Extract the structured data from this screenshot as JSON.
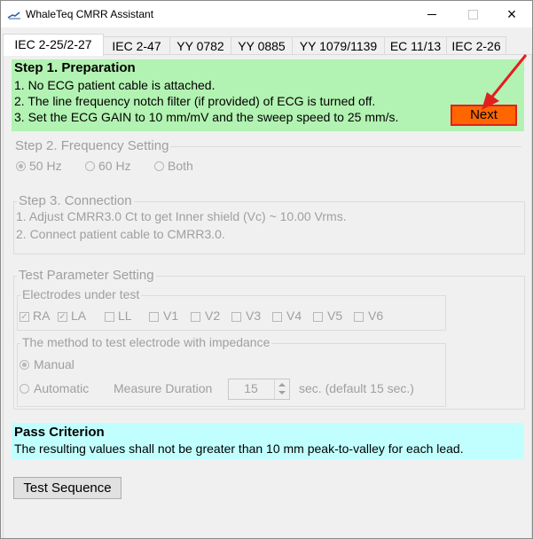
{
  "window": {
    "title": "WhaleTeq CMRR Assistant",
    "controls": {
      "minimize": "minimize",
      "maximize": "maximize",
      "close": "×"
    }
  },
  "tabs": [
    {
      "label": "IEC 2-25/2-27",
      "active": true
    },
    {
      "label": "IEC 2-47",
      "active": false
    },
    {
      "label": "YY 0782",
      "active": false
    },
    {
      "label": "YY 0885",
      "active": false
    },
    {
      "label": "YY 1079/1139",
      "active": false
    },
    {
      "label": "EC 11/13",
      "active": false
    },
    {
      "label": "IEC 2-26",
      "active": false
    }
  ],
  "step1": {
    "heading": "Step 1. Preparation",
    "lines": [
      "1. No ECG patient cable is attached.",
      "2. The line frequency notch filter (if provided) of ECG is turned off.",
      "3. Set the ECG GAIN to 10 mm/mV and the sweep speed to 25 mm/s."
    ],
    "next_label": "Next"
  },
  "step2": {
    "heading": "Step 2. Frequency Setting",
    "options": [
      {
        "label": "50 Hz",
        "selected": true
      },
      {
        "label": "60 Hz",
        "selected": false
      },
      {
        "label": "Both",
        "selected": false
      }
    ]
  },
  "step3": {
    "heading": "Step 3. Connection",
    "lines": [
      "1. Adjust CMRR3.0 Ct to get Inner shield (Vc) ~ 10.00 Vrms.",
      "2. Connect patient cable to CMRR3.0."
    ]
  },
  "params": {
    "heading": "Test Parameter Setting",
    "electrodes_heading": "Electrodes under test",
    "electrodes": [
      {
        "label": "RA",
        "checked": true
      },
      {
        "label": "LA",
        "checked": true
      },
      {
        "label": "LL",
        "checked": false
      },
      {
        "label": "V1",
        "checked": false
      },
      {
        "label": "V2",
        "checked": false
      },
      {
        "label": "V3",
        "checked": false
      },
      {
        "label": "V4",
        "checked": false
      },
      {
        "label": "V5",
        "checked": false
      },
      {
        "label": "V6",
        "checked": false
      }
    ],
    "method_heading": "The method to test electrode with impedance",
    "manual_label": "Manual",
    "automatic_label": "Automatic",
    "duration_label": "Measure Duration",
    "duration_value": "15",
    "duration_unit": "sec. (default 15 sec.)",
    "selected_method": "Manual"
  },
  "pass": {
    "heading": "Pass Criterion",
    "text": "The resulting values shall not be greater than 10 mm peak-to-valley for each lead."
  },
  "test_sequence_label": "Test Sequence",
  "colors": {
    "step1_bg": "#b2f2b2",
    "next_bg": "#ff6600",
    "highlight_red": "#e02020",
    "pass_bg": "#c1ffff"
  }
}
